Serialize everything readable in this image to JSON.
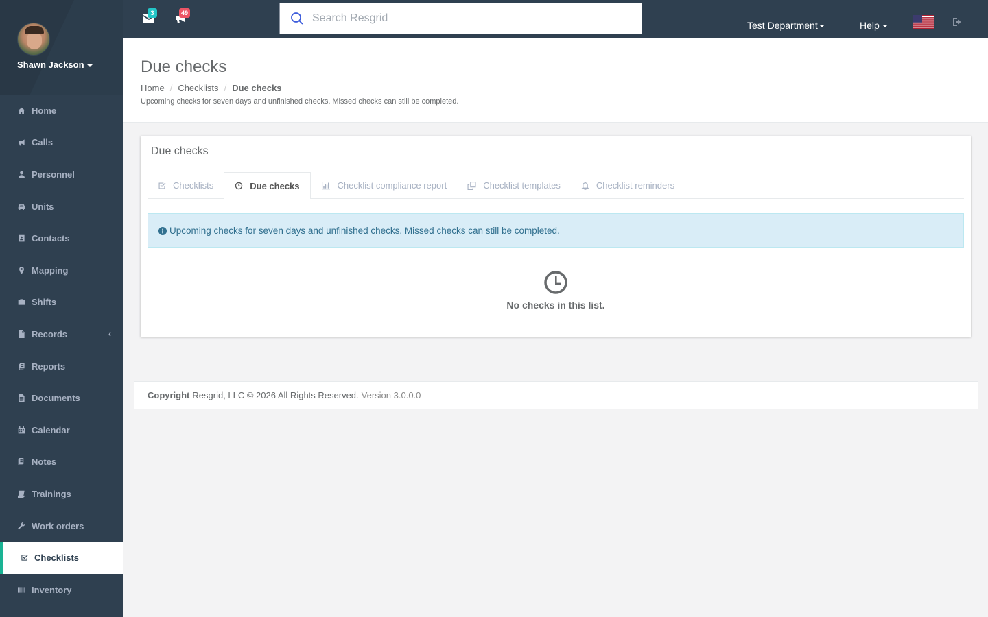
{
  "user": {
    "name": "Shawn Jackson"
  },
  "sidebar": {
    "items": [
      {
        "label": "Home",
        "icon": "home-icon"
      },
      {
        "label": "Calls",
        "icon": "bullhorn-icon"
      },
      {
        "label": "Personnel",
        "icon": "user-icon"
      },
      {
        "label": "Units",
        "icon": "truck-icon"
      },
      {
        "label": "Contacts",
        "icon": "address-book-icon"
      },
      {
        "label": "Mapping",
        "icon": "map-marker-icon"
      },
      {
        "label": "Shifts",
        "icon": "briefcase-icon"
      },
      {
        "label": "Records",
        "icon": "file-icon",
        "chevron": "‹"
      },
      {
        "label": "Reports",
        "icon": "report-icon"
      },
      {
        "label": "Documents",
        "icon": "document-icon"
      },
      {
        "label": "Calendar",
        "icon": "calendar-icon"
      },
      {
        "label": "Notes",
        "icon": "notes-icon"
      },
      {
        "label": "Trainings",
        "icon": "book-icon"
      },
      {
        "label": "Work orders",
        "icon": "wrench-icon"
      },
      {
        "label": "Checklists",
        "icon": "check-square-icon",
        "active": true
      },
      {
        "label": "Inventory",
        "icon": "barcode-icon"
      }
    ]
  },
  "topbar": {
    "mail_count": "3",
    "calls_count": "49",
    "search_placeholder": "Search Resgrid",
    "department": "Test Department",
    "help": "Help",
    "badge_colors": {
      "mail": "#23c6c8",
      "calls": "#ed5565"
    }
  },
  "heading": {
    "title": "Due checks",
    "breadcrumb": [
      "Home",
      "Checklists",
      "Due checks"
    ],
    "description": "Upcoming checks for seven days and unfinished checks. Missed checks can still be completed."
  },
  "panel": {
    "title": "Due checks",
    "tabs": [
      {
        "label": "Checklists",
        "icon": "check-square-icon"
      },
      {
        "label": "Due checks",
        "icon": "clock-icon",
        "active": true
      },
      {
        "label": "Checklist compliance report",
        "icon": "bar-chart-icon"
      },
      {
        "label": "Checklist templates",
        "icon": "copy-icon"
      },
      {
        "label": "Checklist reminders",
        "icon": "bell-icon"
      }
    ],
    "alert": "Upcoming checks for seven days and unfinished checks. Missed checks can still be completed.",
    "empty_text": "No checks in this list."
  },
  "footer": {
    "copyright_label": "Copyright",
    "copyright_text": "Resgrid, LLC © 2026 All Rights Reserved.",
    "version": "Version 3.0.0.0"
  },
  "colors": {
    "sidebar": "#2f4050",
    "accent": "#1ab394",
    "alert_bg": "#d9edf7"
  }
}
